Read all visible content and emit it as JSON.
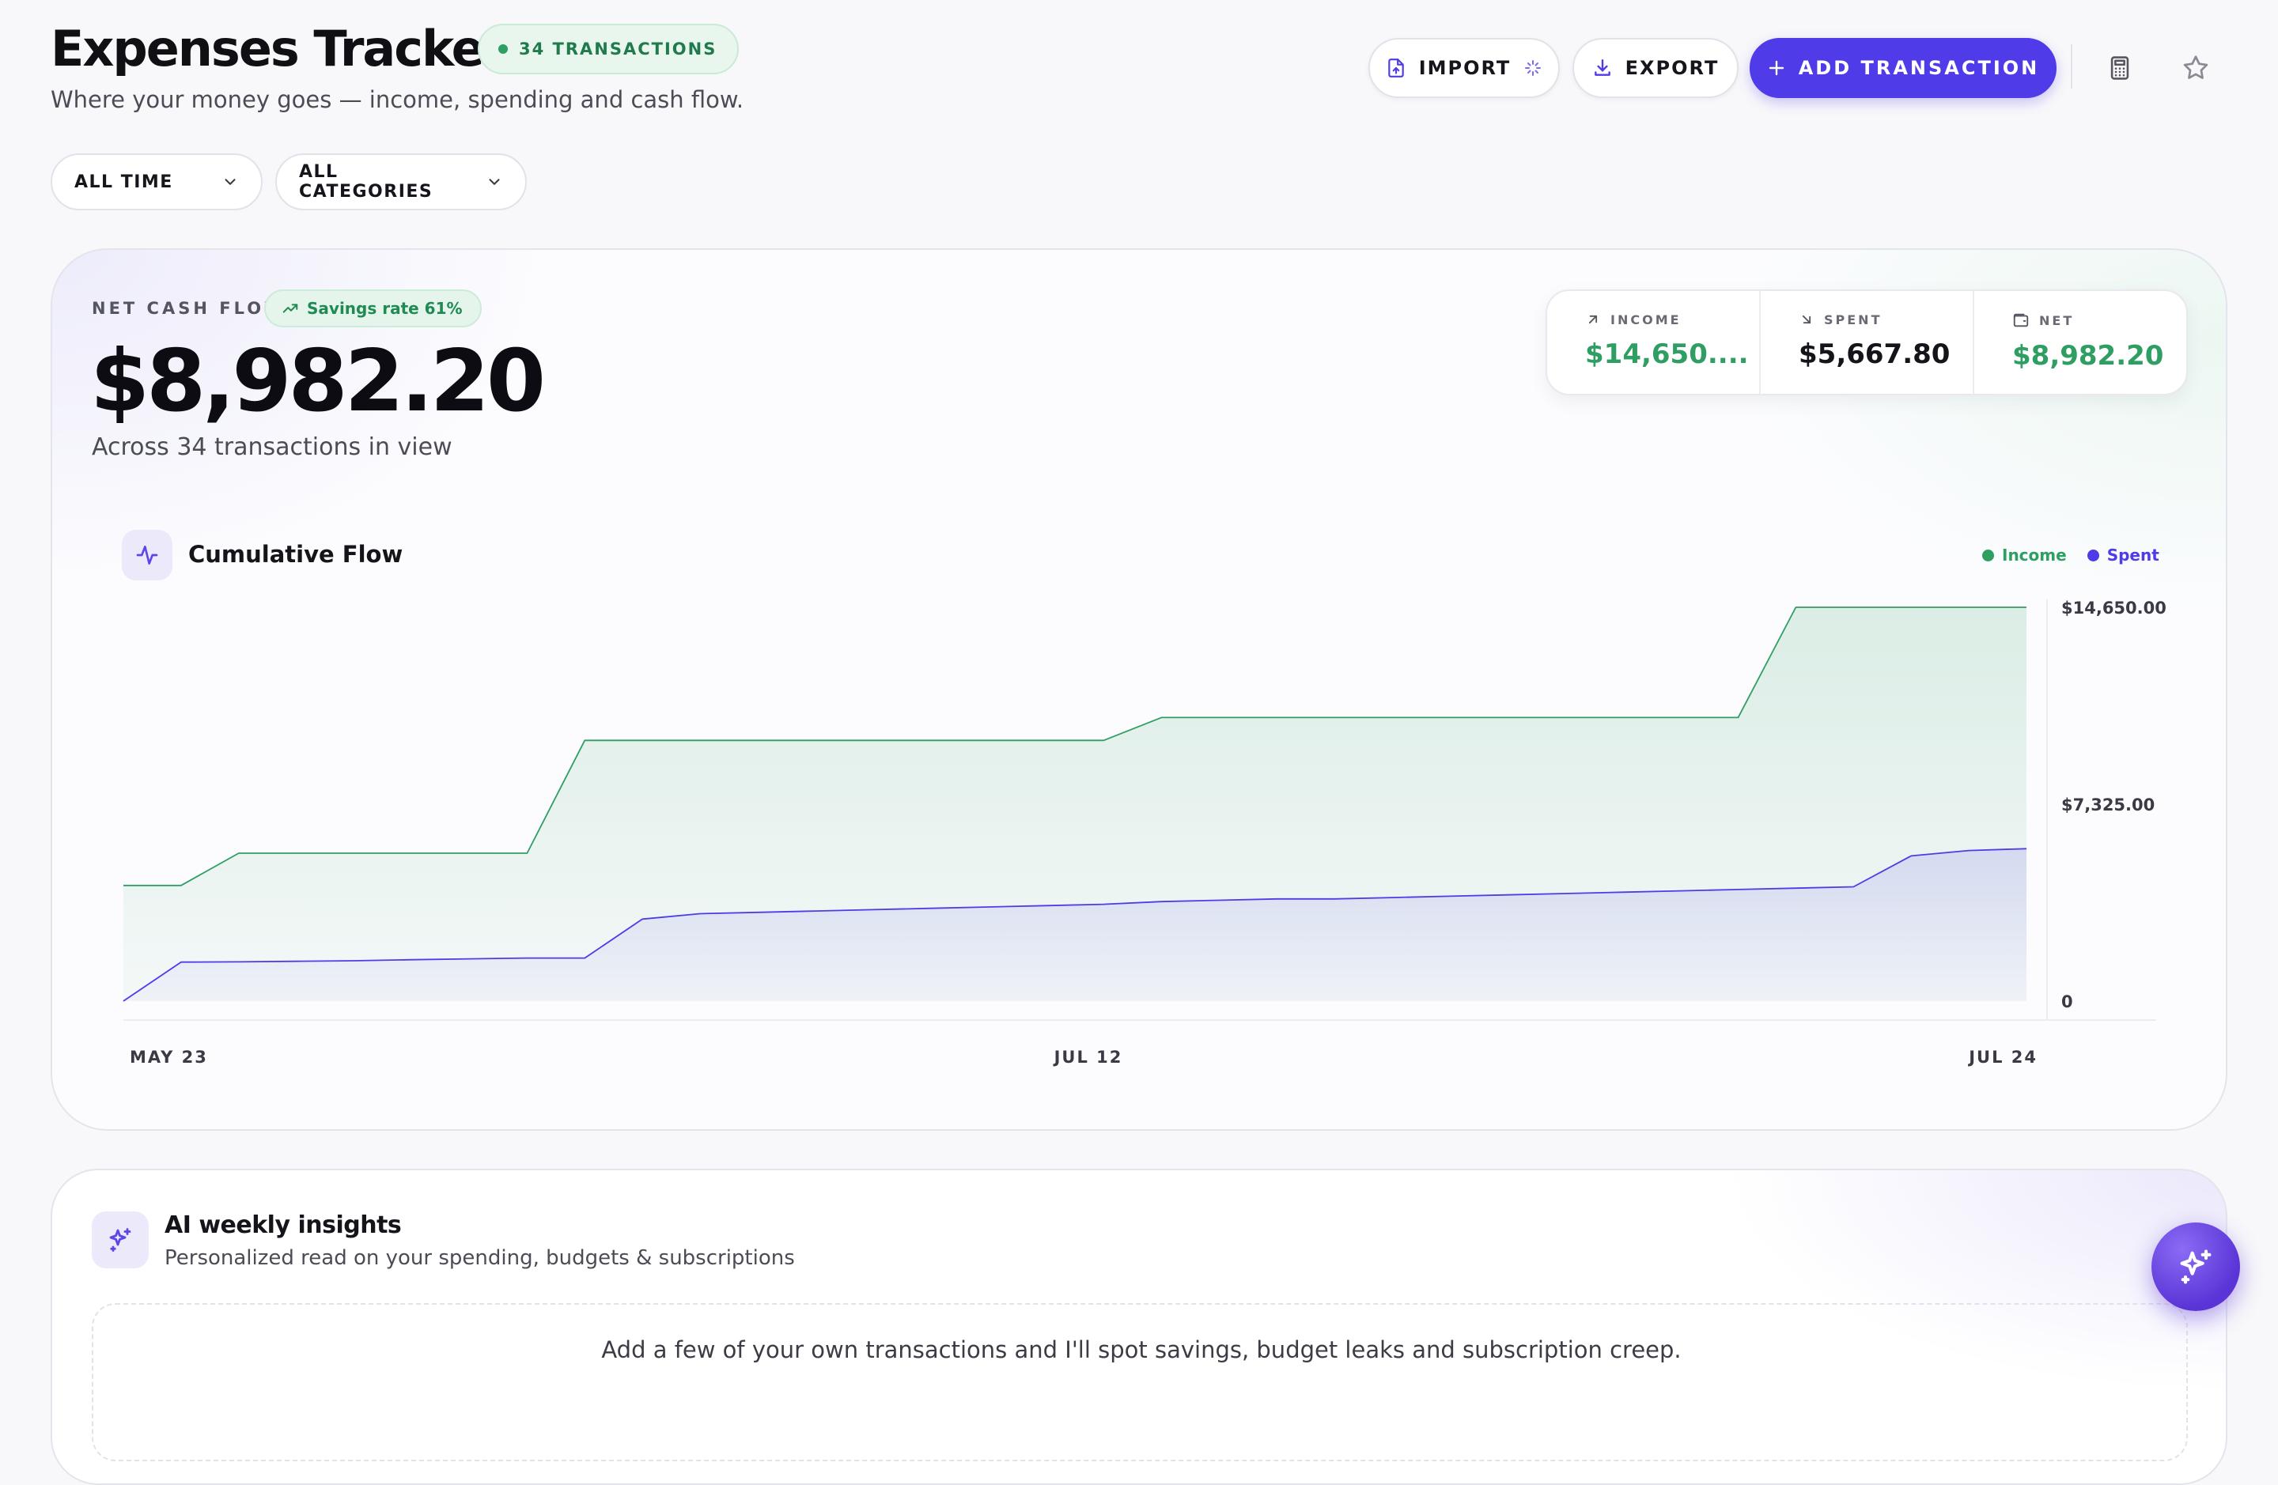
{
  "header": {
    "title": "Expenses Tracker",
    "count_badge": "34 TRANSACTIONS",
    "subtitle": "Where your money goes — income, spending and cash flow.",
    "import_label": "IMPORT",
    "export_label": "EXPORT",
    "add_label": "ADD TRANSACTION"
  },
  "filters": {
    "time": "ALL TIME",
    "category": "ALL CATEGORIES"
  },
  "summary": {
    "label": "NET CASH FLOW",
    "savings_rate": "Savings rate 61%",
    "net_amount": "$8,982.20",
    "caption": "Across 34 transactions in view",
    "stats": {
      "income_label": "INCOME",
      "income_value": "$14,650....",
      "spent_label": "SPENT",
      "spent_value": "$5,667.80",
      "net_label": "NET",
      "net_value": "$8,982.20"
    }
  },
  "chart_data": {
    "type": "area",
    "title": "Cumulative Flow",
    "x_tick_labels": [
      "MAY 23",
      "JUL 12",
      "JUL 24"
    ],
    "y_tick_labels": [
      "$14,650.00",
      "$7,325.00",
      "0"
    ],
    "ylim": [
      0,
      14650
    ],
    "legend": "top-right",
    "series": [
      {
        "name": "Income",
        "color": "#2e9e63",
        "values": [
          4300,
          4300,
          5500,
          5500,
          5500,
          5500,
          5500,
          5500,
          9700,
          9700,
          9700,
          9700,
          9700,
          9700,
          9700,
          9700,
          9700,
          9700,
          10550,
          10550,
          10550,
          10550,
          10550,
          10550,
          10550,
          10550,
          10550,
          10550,
          10550,
          14650,
          14650,
          14650,
          14650,
          14650
        ]
      },
      {
        "name": "Spent",
        "color": "#4f3be8",
        "values": [
          0,
          1450,
          1460,
          1480,
          1500,
          1540,
          1570,
          1600,
          1600,
          3050,
          3250,
          3300,
          3350,
          3400,
          3450,
          3500,
          3550,
          3600,
          3700,
          3750,
          3800,
          3800,
          3850,
          3900,
          3950,
          4000,
          4050,
          4100,
          4150,
          4200,
          4250,
          5400,
          5600,
          5667.8
        ]
      }
    ]
  },
  "insights": {
    "title": "AI weekly insights",
    "subtitle": "Personalized read on your spending, budgets & subscriptions",
    "message": "Add a few of your own transactions and I'll spot savings, budget leaks and subscription creep."
  },
  "colors": {
    "accent": "#4f3be8",
    "income": "#2e9e63",
    "spent": "#4f3be8"
  }
}
